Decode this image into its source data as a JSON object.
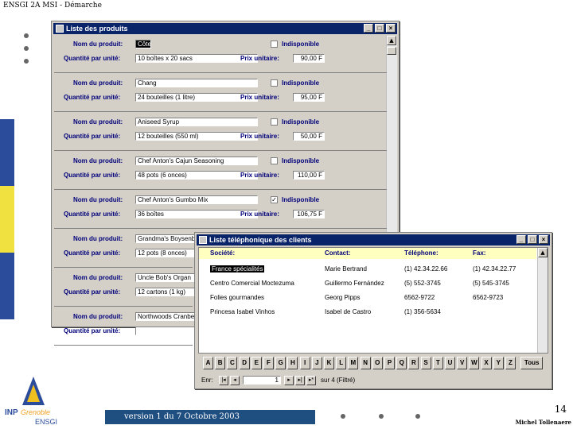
{
  "header": {
    "title": "ENSGI 2A MSI - Démarche"
  },
  "products_window": {
    "title": "Liste des produits",
    "labels": {
      "name": "Nom du produit:",
      "qty": "Quantité par unité:",
      "price": "Prix unitaire:",
      "unavailable": "Indisponible"
    },
    "records": [
      {
        "name": "Côte",
        "qty": "10 boîtes x 20 sacs",
        "price": "90,00 F",
        "unavailable": false
      },
      {
        "name": "Chang",
        "qty": "24 bouteilles (1 litre)",
        "price": "95,00 F",
        "unavailable": false
      },
      {
        "name": "Aniseed Syrup",
        "qty": "12 bouteilles (550 ml)",
        "price": "50,00 F",
        "unavailable": false
      },
      {
        "name": "Chef Anton's Cajun Seasoning",
        "qty": "48 pots (6 onces)",
        "price": "110,00 F",
        "unavailable": false
      },
      {
        "name": "Chef Anton's Gumbo Mix",
        "qty": "36 boîtes",
        "price": "106,75 F",
        "unavailable": true
      },
      {
        "name": "Grandma's Boysenb",
        "qty": "12 pots (8 onces)",
        "price": "",
        "unavailable": false
      },
      {
        "name": "Uncle Bob's Organ",
        "qty": "12 cartons (1 kg)",
        "price": "",
        "unavailable": false
      },
      {
        "name": "Northwoods Cranbe",
        "qty": "",
        "price": "",
        "unavailable": false
      }
    ]
  },
  "clients_window": {
    "title": "Liste téléphonique des clients",
    "columns": [
      "Société:",
      "Contact:",
      "Téléphone:",
      "Fax:"
    ],
    "rows": [
      {
        "company": "France spécialités",
        "contact": "Marie Bertrand",
        "phone": "(1) 42.34.22.66",
        "fax": "(1) 42.34.22.77",
        "selected": true
      },
      {
        "company": "Centro Comercial Moctezuma",
        "contact": "Guillermo Fernández",
        "phone": "(5) 552-3745",
        "fax": "(5) 545-3745",
        "selected": false
      },
      {
        "company": "Folies gourmandes",
        "contact": "Georg Pipps",
        "phone": "6562-9722",
        "fax": "6562-9723",
        "selected": false
      },
      {
        "company": "Princesa Isabel Vinhos",
        "contact": "Isabel de Castro",
        "phone": "(1) 356-5634",
        "fax": "",
        "selected": false
      }
    ],
    "letters": [
      "A",
      "B",
      "C",
      "D",
      "E",
      "F",
      "G",
      "H",
      "I",
      "J",
      "K",
      "L",
      "M",
      "N",
      "O",
      "P",
      "Q",
      "R",
      "S",
      "T",
      "U",
      "V",
      "W",
      "X",
      "Y",
      "Z",
      "Tous"
    ],
    "nav": {
      "label": "Enr:",
      "current": "1",
      "total_text": "sur 4 (Filtré)"
    }
  },
  "footer": {
    "version": "version 1 du 7 Octobre 2003",
    "page": "14",
    "author": "Michel Tollenaere",
    "logo_text": "INP Grenoble ENSGI"
  },
  "colors": {
    "titlebar": "#0a246a",
    "form_bg": "#d4d0c8",
    "label": "#00007a",
    "header_row": "#ffffc0",
    "footer_box": "#1f4e80"
  }
}
